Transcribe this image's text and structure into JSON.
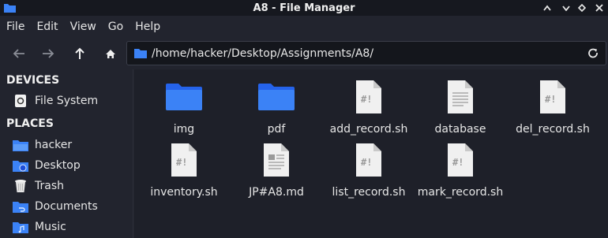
{
  "window": {
    "title": "A8 - File Manager"
  },
  "menu": [
    "File",
    "Edit",
    "View",
    "Go",
    "Help"
  ],
  "address": {
    "path": "/home/hacker/Desktop/Assignments/A8/"
  },
  "sidebar": {
    "devices_header": "DEVICES",
    "devices": [
      {
        "label": "File System",
        "icon": "drive-icon"
      }
    ],
    "places_header": "PLACES",
    "places": [
      {
        "label": "hacker",
        "icon": "home-folder-icon"
      },
      {
        "label": "Desktop",
        "icon": "desktop-icon"
      },
      {
        "label": "Trash",
        "icon": "trash-icon"
      },
      {
        "label": "Documents",
        "icon": "documents-icon"
      },
      {
        "label": "Music",
        "icon": "music-icon"
      }
    ]
  },
  "files": [
    {
      "name": "img",
      "type": "folder"
    },
    {
      "name": "pdf",
      "type": "folder"
    },
    {
      "name": "add_record.sh",
      "type": "script"
    },
    {
      "name": "database",
      "type": "text"
    },
    {
      "name": "del_record.sh",
      "type": "script"
    },
    {
      "name": "inventory.sh",
      "type": "script"
    },
    {
      "name": "JP#A8.md",
      "type": "markdown"
    },
    {
      "name": "list_record.sh",
      "type": "script"
    },
    {
      "name": "mark_record.sh",
      "type": "script"
    }
  ],
  "colors": {
    "accent": "#3b82f6",
    "background": "#1e2029",
    "text": "#e6e6e6"
  }
}
